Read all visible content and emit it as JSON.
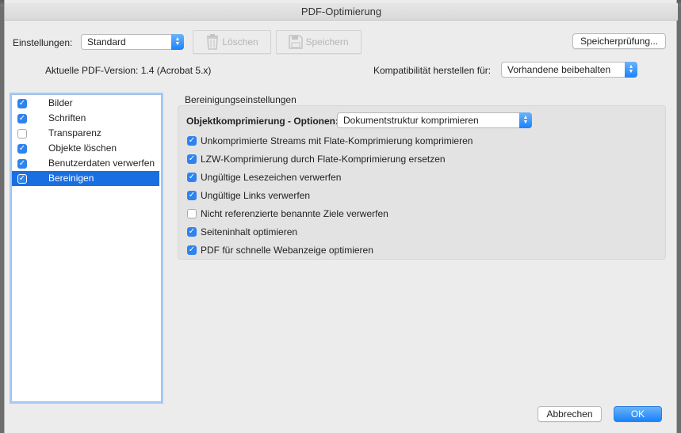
{
  "window": {
    "title": "PDF-Optimierung"
  },
  "top": {
    "settings_label": "Einstellungen:",
    "settings_value": "Standard",
    "delete_label": "Löschen",
    "save_label": "Speichern",
    "check_space_label": "Speicherprüfung...",
    "pdf_version_label": "Aktuelle PDF-Version: 1.4 (Acrobat 5.x)",
    "compat_label": "Kompatibilität herstellen für:",
    "compat_value": "Vorhandene beibehalten"
  },
  "sidebar": {
    "items": [
      {
        "label": "Bilder",
        "checked": true,
        "selected": false
      },
      {
        "label": "Schriften",
        "checked": true,
        "selected": false
      },
      {
        "label": "Transparenz",
        "checked": false,
        "selected": false
      },
      {
        "label": "Objekte löschen",
        "checked": true,
        "selected": false
      },
      {
        "label": "Benutzerdaten verwerfen",
        "checked": true,
        "selected": false
      },
      {
        "label": "Bereinigen",
        "checked": true,
        "selected": true
      }
    ]
  },
  "cleanup": {
    "section_title": "Bereinigungseinstellungen",
    "compression_label": "Objektkomprimierung - Optionen:",
    "compression_value": "Dokumentstruktur komprimieren",
    "options": [
      {
        "label": "Unkomprimierte Streams mit Flate-Komprimierung komprimieren",
        "checked": true
      },
      {
        "label": "LZW-Komprimierung durch Flate-Komprimierung ersetzen",
        "checked": true
      },
      {
        "label": "Ungültige Lesezeichen verwerfen",
        "checked": true
      },
      {
        "label": "Ungültige Links verwerfen",
        "checked": true
      },
      {
        "label": "Nicht referenzierte benannte Ziele verwerfen",
        "checked": false
      },
      {
        "label": "Seiteninhalt optimieren",
        "checked": true
      },
      {
        "label": "PDF für schnelle Webanzeige optimieren",
        "checked": true
      }
    ]
  },
  "footer": {
    "cancel_label": "Abbrechen",
    "ok_label": "OK"
  },
  "colors": {
    "accent": "#1a6fe0",
    "checkbox_on": "#2e83ee"
  },
  "icons": {
    "check": "✓",
    "trash": "trash-icon",
    "save": "floppy-disk-icon"
  }
}
